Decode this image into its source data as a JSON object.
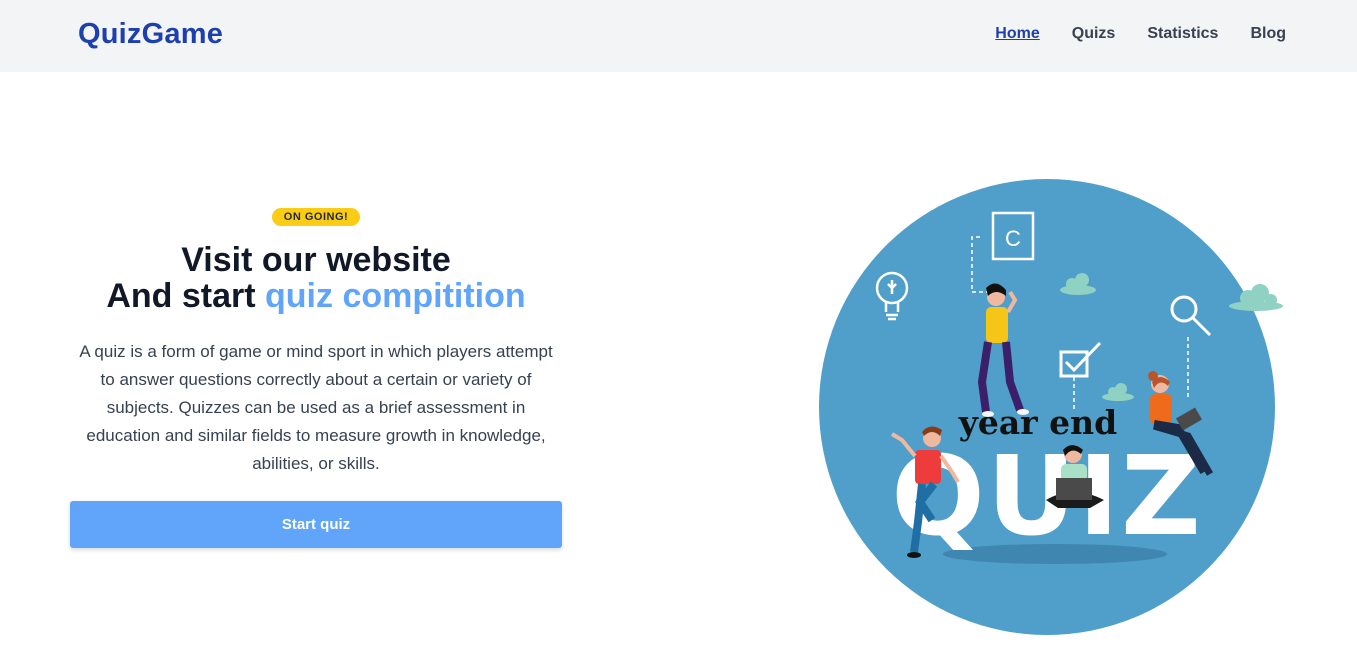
{
  "header": {
    "logo": "QuizGame",
    "nav": [
      {
        "label": "Home",
        "active": true
      },
      {
        "label": "Quizs",
        "active": false
      },
      {
        "label": "Statistics",
        "active": false
      },
      {
        "label": "Blog",
        "active": false
      }
    ]
  },
  "hero": {
    "badge": "ON GOING!",
    "headline_line1": "Visit our website",
    "headline_line2_prefix": "And start ",
    "headline_line2_accent": "quiz compitition",
    "description": "A quiz is a form of game or mind sport in which players attempt to answer questions correctly about a certain or variety of subjects. Quizzes can be used as a brief assessment in education and similar fields to measure growth in knowledge, abilities, or skills.",
    "cta_label": "Start quiz"
  },
  "illustration": {
    "top_text": "year end",
    "big_text": "QUIZ",
    "card_letter": "C"
  },
  "colors": {
    "brand": "#1e40af",
    "accent": "#60a5fa",
    "badge": "#facc15",
    "circle": "#4f9fca"
  }
}
